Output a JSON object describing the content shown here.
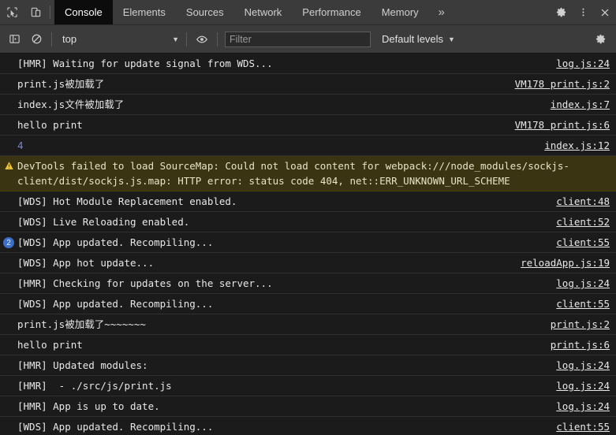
{
  "tabbar": {
    "inspect_icon": "inspect-cursor-icon",
    "device_icon": "device-toolbar-icon",
    "tabs": [
      {
        "label": "Console",
        "active": true
      },
      {
        "label": "Elements",
        "active": false
      },
      {
        "label": "Sources",
        "active": false
      },
      {
        "label": "Network",
        "active": false
      },
      {
        "label": "Performance",
        "active": false
      },
      {
        "label": "Memory",
        "active": false
      }
    ],
    "overflow_label": "»",
    "settings_icon": "gear-icon",
    "menu_icon": "more-vertical-icon",
    "close_icon": "close-icon"
  },
  "filterbar": {
    "sidebar_toggle_icon": "console-sidebar-icon",
    "clear_icon": "clear-console-icon",
    "context": "top",
    "context_caret": "▼",
    "eye_icon": "live-expression-eye-icon",
    "filter_placeholder": "Filter",
    "filter_value": "",
    "levels_label": "Default levels",
    "levels_caret": "▼",
    "settings_icon": "console-settings-gear-icon"
  },
  "console": {
    "rows": [
      {
        "type": "log",
        "badge": "",
        "message": "[HMR] Waiting for update signal from WDS...",
        "source": "log.js:24"
      },
      {
        "type": "log",
        "badge": "",
        "message": "print.js被加载了",
        "source": "VM178 print.js:2"
      },
      {
        "type": "log",
        "badge": "",
        "message": "index.js文件被加载了",
        "source": "index.js:7"
      },
      {
        "type": "log",
        "badge": "",
        "message": "hello print",
        "source": "VM178 print.js:6"
      },
      {
        "type": "number",
        "badge": "",
        "message": "4",
        "source": "index.js:12"
      },
      {
        "type": "warning",
        "badge": "",
        "message_pre": "DevTools failed to load SourceMap: Could not load content for ",
        "message_link": "webpack:///node_modules/sockjs-client/dist/sockjs.js.map",
        "message_post": ": HTTP error: status code 404, net::ERR_UNKNOWN_URL_SCHEME",
        "source": ""
      },
      {
        "type": "log",
        "badge": "",
        "message": "[WDS] Hot Module Replacement enabled.",
        "source": "client:48"
      },
      {
        "type": "log",
        "badge": "",
        "message": "[WDS] Live Reloading enabled.",
        "source": "client:52"
      },
      {
        "type": "log",
        "badge": "2",
        "message": "[WDS] App updated. Recompiling...",
        "source": "client:55"
      },
      {
        "type": "log",
        "badge": "",
        "message": "[WDS] App hot update...",
        "source": "reloadApp.js:19"
      },
      {
        "type": "log",
        "badge": "",
        "message": "[HMR] Checking for updates on the server...",
        "source": "log.js:24"
      },
      {
        "type": "log",
        "badge": "",
        "message": "[WDS] App updated. Recompiling...",
        "source": "client:55"
      },
      {
        "type": "log",
        "badge": "",
        "message": "print.js被加载了~~~~~~~",
        "source": "print.js:2"
      },
      {
        "type": "log",
        "badge": "",
        "message": "hello print",
        "source": "print.js:6"
      },
      {
        "type": "log",
        "badge": "",
        "message": "[HMR] Updated modules:",
        "source": "log.js:24"
      },
      {
        "type": "log",
        "badge": "",
        "message": "[HMR]  - ./src/js/print.js",
        "source": "log.js:24"
      },
      {
        "type": "log",
        "badge": "",
        "message": "[HMR] App is up to date.",
        "source": "log.js:24"
      },
      {
        "type": "log",
        "badge": "",
        "message": "[WDS] App updated. Recompiling...",
        "source": "client:55"
      }
    ]
  },
  "colors": {
    "toolbar_bg": "#3b3b3b",
    "console_bg": "#1b1b1b",
    "active_tab_bg": "#0c0c0c",
    "warning_bg": "#3a3413",
    "badge_blue": "#3b6ec9",
    "number_blue": "#7986cb"
  }
}
